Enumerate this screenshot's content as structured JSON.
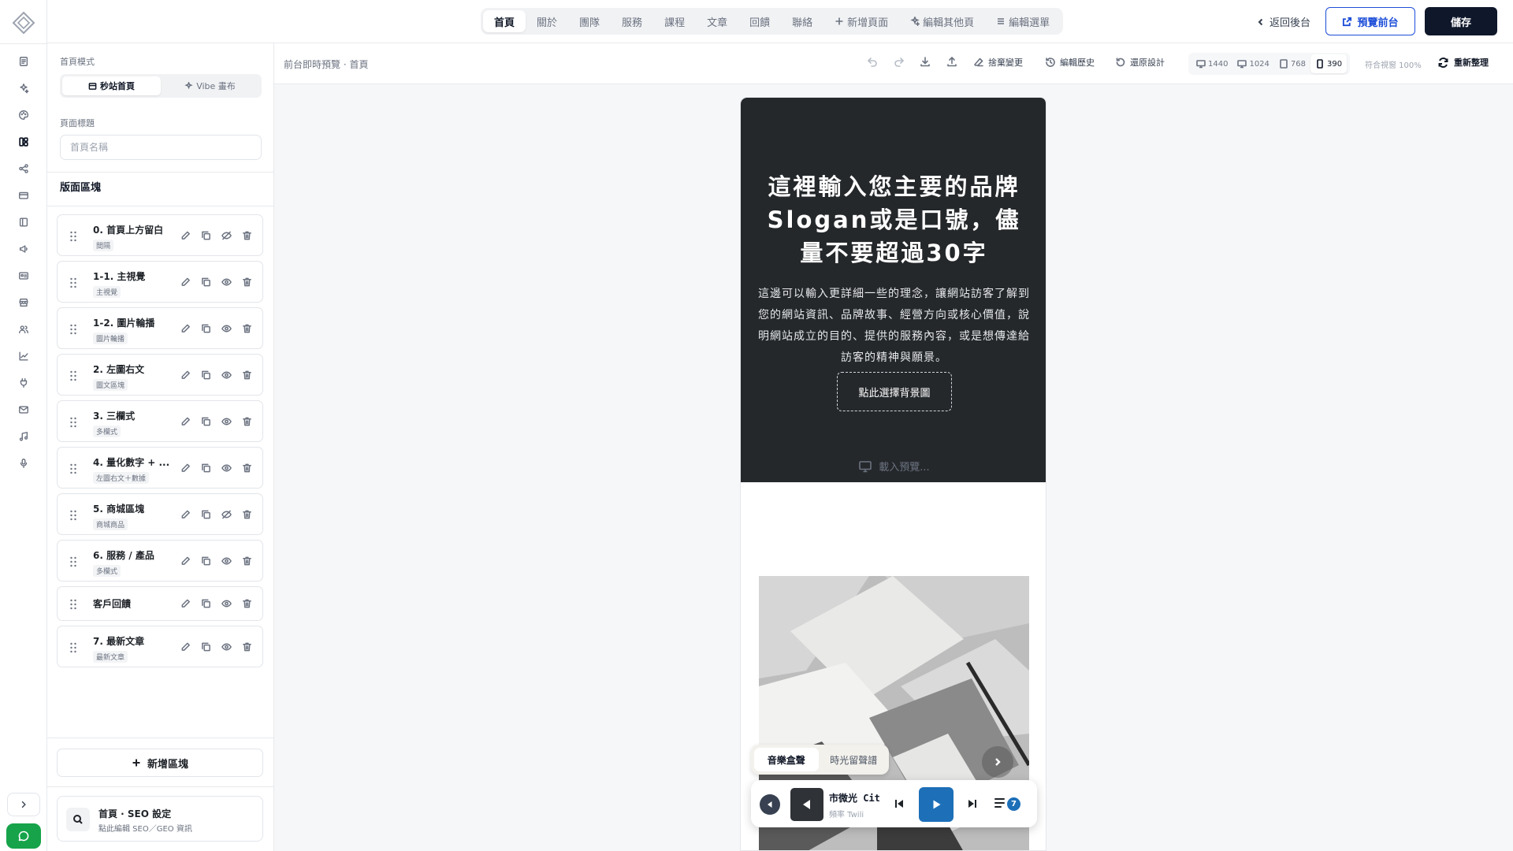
{
  "topbar": {
    "tabs": [
      {
        "label": "首頁",
        "active": true
      },
      {
        "label": "關於"
      },
      {
        "label": "團隊"
      },
      {
        "label": "服務"
      },
      {
        "label": "課程"
      },
      {
        "label": "文章"
      },
      {
        "label": "回饋"
      },
      {
        "label": "聯絡"
      }
    ],
    "add_page": "新增頁面",
    "edit_other": "編輯其他頁",
    "edit_menu": "編輯選單",
    "back_label": "返回後台",
    "preview_label": "預覽前台",
    "save_label": "儲存",
    "accent_color": "#1d4ed8"
  },
  "sidebar": {
    "mode_label": "首頁模式",
    "modes": [
      "秒站首頁",
      "Vibe 畫布"
    ],
    "title_label": "頁面標題",
    "title_placeholder": "首頁名稱",
    "blocks_heading": "版面區塊",
    "blocks": [
      {
        "name": "0. 首頁上方留白",
        "tag": "間隔",
        "visible": false
      },
      {
        "name": "1-1. 主視覺",
        "tag": "主視覺",
        "visible": true
      },
      {
        "name": "1-2. 圖片輪播",
        "tag": "圖片輪播",
        "visible": true
      },
      {
        "name": "2. 左圖右文",
        "tag": "圖文區塊",
        "visible": true
      },
      {
        "name": "3. 三欄式",
        "tag": "多欄式",
        "visible": true
      },
      {
        "name": "4. 量化數字 + ...",
        "tag": "左圖右文＋數據",
        "visible": true
      },
      {
        "name": "5. 商城區塊",
        "tag": "商城商品",
        "visible": false
      },
      {
        "name": "6. 服務 / 產品",
        "tag": "多欄式",
        "visible": true
      },
      {
        "name": "客戶回饋",
        "tag": "",
        "visible": true
      },
      {
        "name": "7. 最新文章",
        "tag": "最新文章",
        "visible": true
      }
    ],
    "add_block": "新增區塊",
    "seo_title": "首頁 · SEO 設定",
    "seo_subtitle": "點此編輯 SEO／GEO 資訊"
  },
  "toolbar": {
    "breadcrumb": "前台即時預覽 · 首頁",
    "discard": "捨棄變更",
    "history": "編輯歷史",
    "restore": "還原設計",
    "viewports": [
      "1440",
      "1024",
      "768",
      "390"
    ],
    "active_viewport": "390",
    "fit_label": "符合視窗 100%",
    "refresh": "重新整理"
  },
  "preview": {
    "hero_title": "這裡輸入您主要的品牌Slogan或是口號，儘量不要超過30字",
    "hero_desc": "這邊可以輸入更詳細一些的理念，讓網站訪客了解到您的網站資訊、品牌故事、經營方向或核心價值，說明網站成立的目的、提供的服務內容，或是想傳達給訪客的精神與願景。",
    "bg_button": "點此選擇背景圖",
    "loading": "載入預覽..."
  },
  "player": {
    "tabs": [
      "音樂盒聲",
      "時光留聲譜"
    ],
    "track_title": "市微光 Cit",
    "track_sub": "頻率 Twili",
    "queue_count": "7"
  }
}
